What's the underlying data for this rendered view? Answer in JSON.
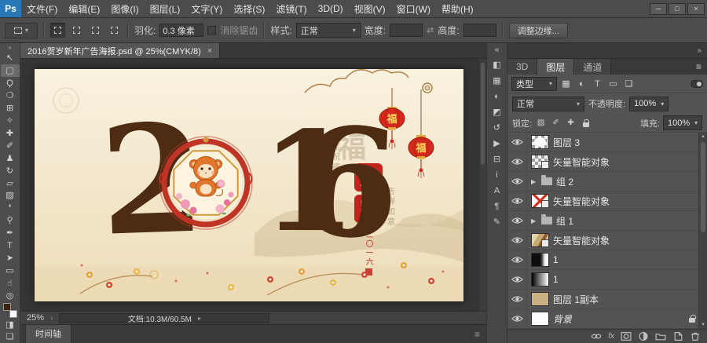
{
  "app": {
    "logo": "Ps",
    "menus": [
      "文件(F)",
      "编辑(E)",
      "图像(I)",
      "图层(L)",
      "文字(Y)",
      "选择(S)",
      "滤镜(T)",
      "3D(D)",
      "视图(V)",
      "窗口(W)",
      "帮助(H)"
    ],
    "window_buttons": {
      "minimize": "─",
      "maximize": "□",
      "close": "×"
    }
  },
  "options_bar": {
    "dropdown_arrow": "▾",
    "feather_label": "羽化:",
    "feather_value": "0.3 像素",
    "antialias_label": "消除锯齿",
    "style_label": "样式:",
    "style_value": "正常",
    "width_label": "宽度:",
    "swap_icon": "⇄",
    "height_label": "高度:",
    "refine_edge_label": "调整边缘..."
  },
  "toolbar": {
    "collapse_icon": "»",
    "tools": [
      {
        "name": "move-tool",
        "glyph": "↖"
      },
      {
        "name": "rectangular-marquee-tool",
        "glyph": "▢"
      },
      {
        "name": "lasso-tool",
        "glyph": "Ϙ"
      },
      {
        "name": "quick-selection-tool",
        "glyph": "❍"
      },
      {
        "name": "crop-tool",
        "glyph": "⊞"
      },
      {
        "name": "eyedropper-tool",
        "glyph": "✧"
      },
      {
        "name": "healing-brush-tool",
        "glyph": "✚"
      },
      {
        "name": "brush-tool",
        "glyph": "✐"
      },
      {
        "name": "clone-stamp-tool",
        "glyph": "♟"
      },
      {
        "name": "history-brush-tool",
        "glyph": "↻"
      },
      {
        "name": "eraser-tool",
        "glyph": "▱"
      },
      {
        "name": "gradient-tool",
        "glyph": "▨"
      },
      {
        "name": "blur-tool",
        "glyph": "❛"
      },
      {
        "name": "dodge-tool",
        "glyph": "⚲"
      },
      {
        "name": "pen-tool",
        "glyph": "✒"
      },
      {
        "name": "type-tool",
        "glyph": "T"
      },
      {
        "name": "path-selection-tool",
        "glyph": "➤"
      },
      {
        "name": "shape-tool",
        "glyph": "▭"
      },
      {
        "name": "hand-tool",
        "glyph": "☝"
      },
      {
        "name": "zoom-tool",
        "glyph": "◎"
      }
    ],
    "quick_mask_glyph": "◨",
    "screen_mode_glyph": "❏"
  },
  "document": {
    "tab_title": "2016贺岁新年广告海报.psd @ 25%(CMYK/8)",
    "close_icon": "×",
    "zoom": "25%",
    "status_chevron": "›",
    "doc_info": "文档:10.3M/60.5M",
    "doc_info_arrow": "▸"
  },
  "timeline": {
    "tab_label": "时间轴",
    "menu_icon": "≡"
  },
  "rail": {
    "collapse_icon": "«",
    "icons": [
      {
        "name": "color-panel-icon",
        "glyph": "◧"
      },
      {
        "name": "swatches-panel-icon",
        "glyph": "▦"
      },
      {
        "name": "adjustments-panel-icon",
        "glyph": "◐"
      },
      {
        "name": "styles-panel-icon",
        "glyph": "◩"
      },
      {
        "name": "history-panel-icon",
        "glyph": "↺"
      },
      {
        "name": "actions-panel-icon",
        "glyph": "▶"
      },
      {
        "name": "properties-panel-icon",
        "glyph": "⊟"
      },
      {
        "name": "info-panel-icon",
        "glyph": "i"
      },
      {
        "name": "character-panel-icon",
        "glyph": "A"
      },
      {
        "name": "paragraph-panel-icon",
        "glyph": "¶"
      },
      {
        "name": "notes-panel-icon",
        "glyph": "✎"
      }
    ]
  },
  "panels": {
    "collapse_icon": "»",
    "tabs": [
      {
        "label": "3D"
      },
      {
        "label": "图层"
      },
      {
        "label": "通道"
      }
    ],
    "menu_icon": "≡",
    "filter": {
      "label": "类型",
      "arrow": "▾",
      "icons": [
        {
          "name": "pixel-layer-filter-icon",
          "glyph": "▦"
        },
        {
          "name": "adjustment-layer-filter-icon",
          "glyph": "◐"
        },
        {
          "name": "type-layer-filter-icon",
          "glyph": "T"
        },
        {
          "name": "shape-layer-filter-icon",
          "glyph": "▭"
        },
        {
          "name": "smart-object-filter-icon",
          "glyph": "❏"
        }
      ]
    },
    "blend": {
      "mode": "正常",
      "arrow": "▾",
      "opacity_label": "不透明度:",
      "opacity_value": "100%"
    },
    "lock": {
      "label": "锁定:",
      "icons": [
        {
          "name": "lock-transparency-icon",
          "glyph": "▨"
        },
        {
          "name": "lock-paint-icon",
          "glyph": "✐"
        },
        {
          "name": "lock-position-icon",
          "glyph": "✚"
        }
      ],
      "fill_label": "填充:",
      "fill_value": "100%"
    },
    "layers": [
      {
        "name": "图层 3"
      },
      {
        "name": "矢量智能对象"
      },
      {
        "name": "组 2"
      },
      {
        "name": "矢量智能对象"
      },
      {
        "name": "组 1"
      },
      {
        "name": "矢量智能对象"
      },
      {
        "name": "1"
      },
      {
        "name": "1"
      },
      {
        "name": "图层 1副本"
      },
      {
        "name": "背景"
      }
    ],
    "fx_label": "fx"
  },
  "poster": {
    "digit_2": "2",
    "digit_1": "1",
    "digit_6": "6",
    "lantern_char": "福",
    "watermark_char": "福",
    "seal_top_char": "贺",
    "seal_bottom_char": "岁",
    "greeting_column_1": "新年祝福",
    "greeting_column_2": "吉祥如意",
    "year_column": "二〇一六",
    "colors": {
      "background": "#f6eed8",
      "ink": "#4e2c13",
      "red": "#c2231c",
      "gold": "#d9a441",
      "lantern_red": "#d42a1d"
    }
  }
}
